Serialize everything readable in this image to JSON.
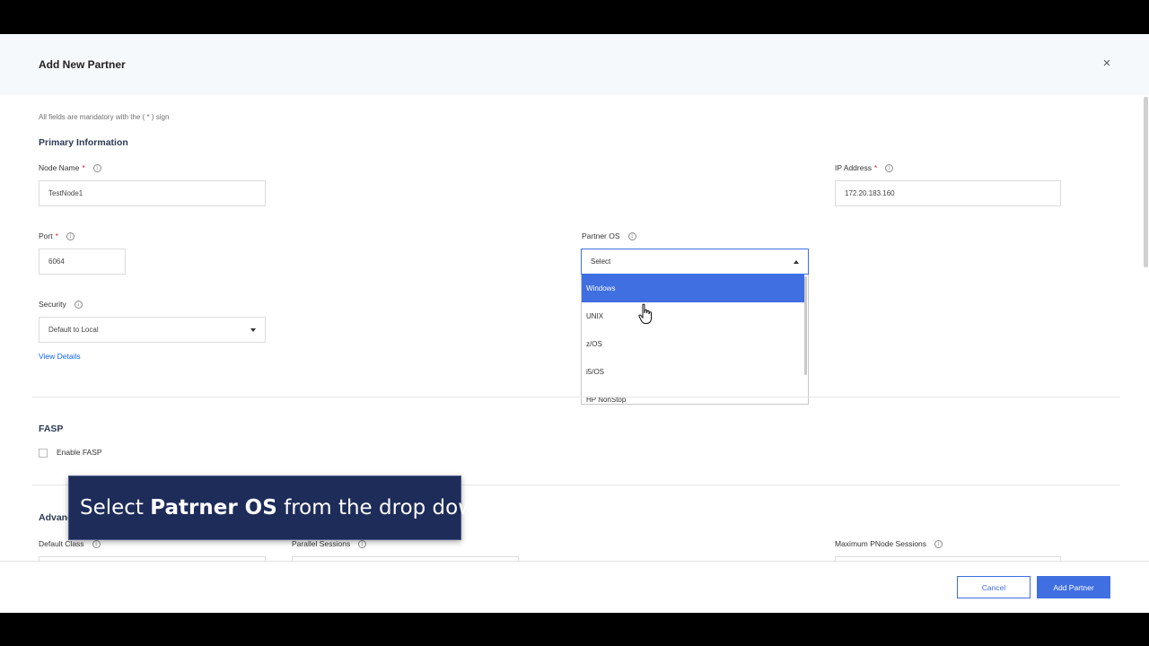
{
  "modal": {
    "title": "Add New Partner",
    "close_label": "×",
    "helper_text": "All fields are mandatory with the ( * ) sign"
  },
  "primary": {
    "section_title": "Primary Information",
    "node_name": {
      "label": "Node Name",
      "required": "*",
      "value": "TestNode1"
    },
    "ip_address": {
      "label": "IP Address",
      "required": "*",
      "value": "172.20.183.160"
    },
    "port": {
      "label": "Port",
      "required": "*",
      "value": "6064"
    },
    "partner_os": {
      "label": "Partner OS",
      "selected": "Select",
      "options": [
        "Windows",
        "UNIX",
        "z/OS",
        "i5/OS",
        "HP NonStop"
      ],
      "highlighted": "Windows"
    },
    "security": {
      "label": "Security",
      "value": "Default to Local"
    },
    "view_details": "View Details"
  },
  "fasp": {
    "section_title": "FASP",
    "enable_label": "Enable FASP",
    "checked": false
  },
  "advanced": {
    "section_title_visible": "Advanc",
    "default_class": {
      "label": "Default Class"
    },
    "parallel_sessions": {
      "label": "Parallel Sessions"
    },
    "max_pnode_sessions": {
      "label": "Maximum PNode Sessions"
    }
  },
  "footer": {
    "cancel_label": "Cancel",
    "submit_label": "Add Partner"
  },
  "caption": {
    "prefix": "Select ",
    "bold": "Patrner OS",
    "suffix": " from the drop down"
  },
  "icons": {
    "info": "i",
    "close": "close-icon",
    "caret": "chevron-down-icon"
  },
  "colors": {
    "accent": "#3f6fe0",
    "header_bg": "#f6f9fc",
    "required": "#da1e28",
    "caption_bg": "#1e2c5a"
  }
}
